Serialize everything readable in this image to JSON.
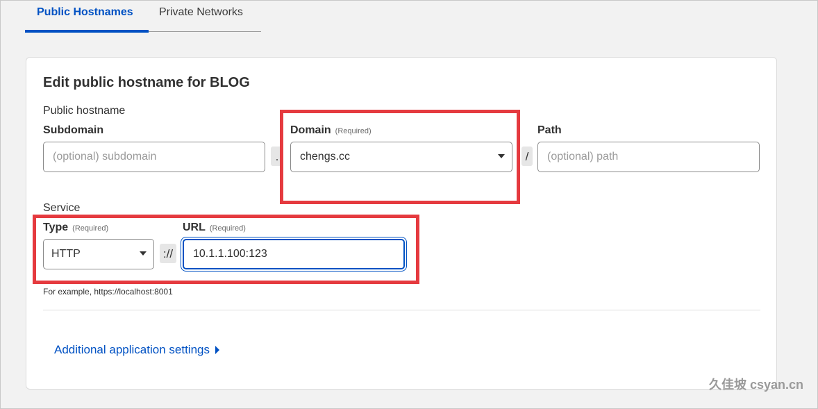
{
  "tabs": {
    "active": "Public Hostnames",
    "inactive": "Private Networks"
  },
  "card": {
    "title": "Edit public hostname for BLOG",
    "public_hostname_label": "Public hostname",
    "subdomain": {
      "label": "Subdomain",
      "placeholder": "(optional) subdomain"
    },
    "domain_separator": ".",
    "domain": {
      "label": "Domain",
      "required": "(Required)",
      "value": "chengs.cc"
    },
    "path_separator": "/",
    "path": {
      "label": "Path",
      "placeholder": "(optional) path"
    },
    "service_label": "Service",
    "type": {
      "label": "Type",
      "required": "(Required)",
      "value": "HTTP"
    },
    "scheme_separator": "://",
    "url": {
      "label": "URL",
      "required": "(Required)",
      "value": "10.1.1.100:123"
    },
    "hint": "For example, https://localhost:8001",
    "additional_settings": "Additional application settings"
  },
  "watermark": "久佳坡 csyan.cn",
  "colors": {
    "accent": "#0051c3",
    "highlight": "#e53a3f"
  }
}
